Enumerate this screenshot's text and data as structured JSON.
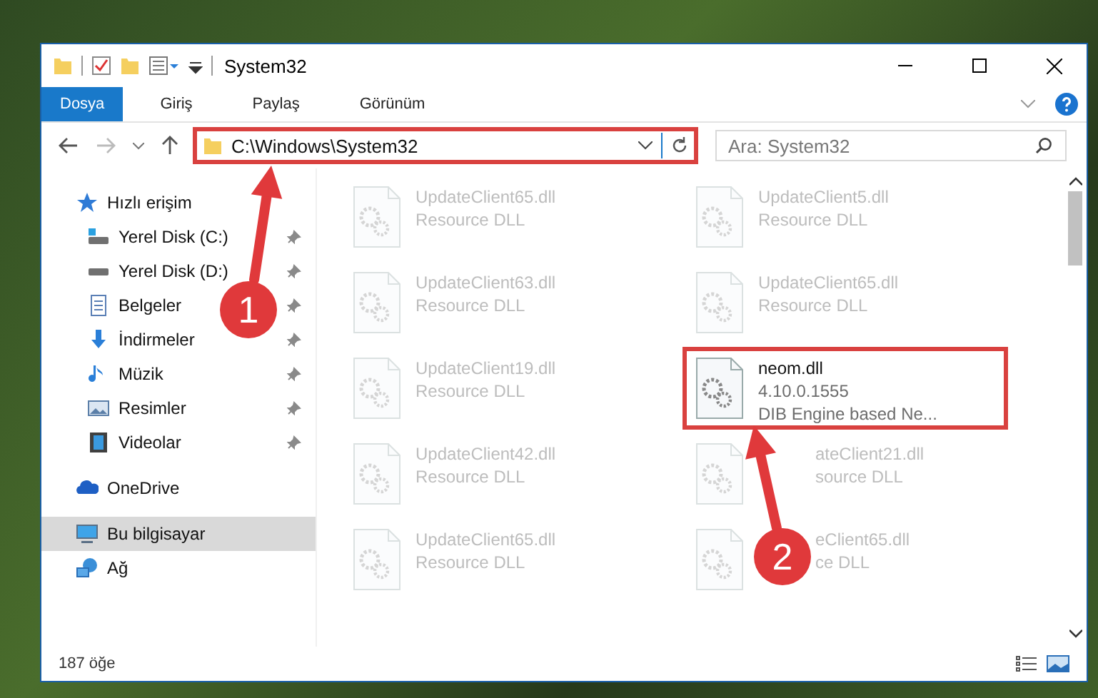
{
  "window": {
    "title": "System32"
  },
  "ribbon_tabs": [
    {
      "label": "Dosya",
      "selected": true
    },
    {
      "label": "Giriş",
      "selected": false
    },
    {
      "label": "Paylaş",
      "selected": false
    },
    {
      "label": "Görünüm",
      "selected": false
    }
  ],
  "address_bar": {
    "path": "C:\\Windows\\System32",
    "highlighted": true
  },
  "search": {
    "placeholder": "Ara: System32"
  },
  "sidebar": [
    {
      "label": "Hızlı erişim",
      "kind": "star",
      "selected": false,
      "children": [
        {
          "label": "Yerel Disk (C:)",
          "kind": "system-drive",
          "pinned": true,
          "selected": false
        },
        {
          "label": "Yerel Disk (D:)",
          "kind": "drive",
          "pinned": true,
          "selected": false
        },
        {
          "label": "Belgeler",
          "kind": "document",
          "pinned": true,
          "selected": false
        },
        {
          "label": "İndirmeler",
          "kind": "download",
          "pinned": true,
          "selected": false
        },
        {
          "label": "Müzik",
          "kind": "music",
          "pinned": true,
          "selected": false
        },
        {
          "label": "Resimler",
          "kind": "pictures",
          "pinned": true,
          "selected": false
        },
        {
          "label": "Videolar",
          "kind": "videos",
          "pinned": true,
          "selected": false
        }
      ]
    },
    {
      "label": "OneDrive",
      "kind": "cloud",
      "selected": false
    },
    {
      "label": "Bu bilgisayar",
      "kind": "computer",
      "selected": true
    },
    {
      "label": "Ağ",
      "kind": "network",
      "selected": false
    }
  ],
  "files": [
    {
      "name": "UpdateClient65.dll",
      "description": "Resource DLL",
      "blurred": true,
      "highlighted": false,
      "partly_hidden": false
    },
    {
      "name": "UpdateClient5.dll",
      "description": "Resource DLL",
      "blurred": true,
      "highlighted": false,
      "partly_hidden": false
    },
    {
      "name": "UpdateClient63.dll",
      "description": "Resource DLL",
      "blurred": true,
      "highlighted": false,
      "partly_hidden": false
    },
    {
      "name": "UpdateClient65.dll",
      "description": "Resource DLL",
      "blurred": true,
      "highlighted": false,
      "partly_hidden": false
    },
    {
      "name": "UpdateClient19.dll",
      "description": "Resource DLL",
      "blurred": true,
      "highlighted": false,
      "partly_hidden": false
    },
    {
      "name": "neom.dll",
      "version": "4.10.0.1555",
      "description": "DIB Engine based Ne...",
      "blurred": false,
      "highlighted": true,
      "partly_hidden": false
    },
    {
      "name": "UpdateClient42.dll",
      "description": "Resource DLL",
      "blurred": true,
      "highlighted": false,
      "partly_hidden": false
    },
    {
      "name": "ateClient21.dll",
      "description": "source DLL",
      "blurred": true,
      "highlighted": false,
      "partly_hidden": true
    },
    {
      "name": "UpdateClient65.dll",
      "description": "Resource DLL",
      "blurred": true,
      "highlighted": false,
      "partly_hidden": false
    },
    {
      "name": "eClient65.dll",
      "description": "ce DLL",
      "blurred": true,
      "highlighted": false,
      "partly_hidden": true
    }
  ],
  "status_bar": {
    "item_count": "187 öğe"
  },
  "annotations": [
    {
      "number": "1"
    },
    {
      "number": "2"
    }
  ]
}
